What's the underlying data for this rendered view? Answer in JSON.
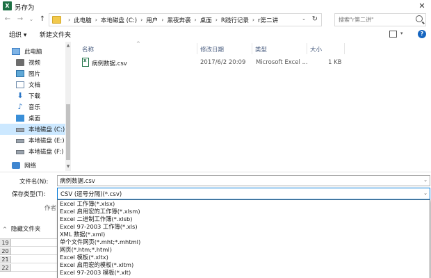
{
  "window": {
    "app_icon_letter": "X",
    "title": "另存为",
    "close_glyph": "✕",
    "accent_color": "#0078d7",
    "excel_green": "#1d7044"
  },
  "nav_buttons": {
    "back": "←",
    "forward": "→",
    "recent": "⌄",
    "up": "↑"
  },
  "address": {
    "crumbs": [
      "此电脑",
      "本地磁盘 (C:)",
      "用户",
      "黑夜奔袭",
      "桌面",
      "R践行记录",
      "r第二讲"
    ],
    "separator": "›",
    "dropdown_glyph": "⌄",
    "refresh_glyph": "↻"
  },
  "search": {
    "placeholder": "搜索\"r第二讲\""
  },
  "toolbar": {
    "organize": "组织 ▾",
    "new_folder": "新建文件夹",
    "view_drop": "▾",
    "help": "?"
  },
  "nav": {
    "items": [
      {
        "label": "此电脑",
        "icon": "computer-icon"
      },
      {
        "label": "视频",
        "icon": "video-icon"
      },
      {
        "label": "图片",
        "icon": "pictures-icon"
      },
      {
        "label": "文档",
        "icon": "documents-icon"
      },
      {
        "label": "下载",
        "icon": "download-icon",
        "glyph": "⬇"
      },
      {
        "label": "音乐",
        "icon": "music-icon",
        "glyph": "♪"
      },
      {
        "label": "桌面",
        "icon": "desktop-icon"
      },
      {
        "label": "本地磁盘 (C:)",
        "icon": "drive-icon",
        "selected": true
      },
      {
        "label": "本地磁盘 (E:)",
        "icon": "drive-icon"
      },
      {
        "label": "本地磁盘 (F:)",
        "icon": "drive-icon"
      },
      {
        "label": "网络",
        "icon": "network-icon"
      }
    ],
    "scroll_up": "▲",
    "scroll_down": "▼"
  },
  "file_list": {
    "columns": [
      "名称",
      "修改日期",
      "类型",
      "大小"
    ],
    "sort_caret": "^",
    "rows": [
      {
        "name": "病例数据.csv",
        "modified": "2017/6/2 20:09",
        "type": "Microsoft Excel ...",
        "size": "1 KB"
      }
    ]
  },
  "form": {
    "filename_label": "文件名(N):",
    "filename_value": "病例数据.csv",
    "filetype_label": "保存类型(T):",
    "filetype_value": "CSV (逗号分隔)(*.csv)",
    "author_label": "作者:",
    "drop_glyph": "⌄",
    "hide_folders": "隐藏文件夹",
    "hide_caret": "^"
  },
  "file_types": [
    "Excel 工作簿(*.xlsx)",
    "Excel 启用宏的工作簿(*.xlsm)",
    "Excel 二进制工作簿(*.xlsb)",
    "Excel 97-2003 工作簿(*.xls)",
    "XML 数据(*.xml)",
    "单个文件网页(*.mht;*.mhtml)",
    "网页(*.htm;*.html)",
    "Excel 模板(*.xltx)",
    "Excel 启用宏的模板(*.xltm)",
    "Excel 97-2003 模板(*.xlt)"
  ],
  "excel_rows": [
    "19",
    "20",
    "21",
    "22"
  ]
}
